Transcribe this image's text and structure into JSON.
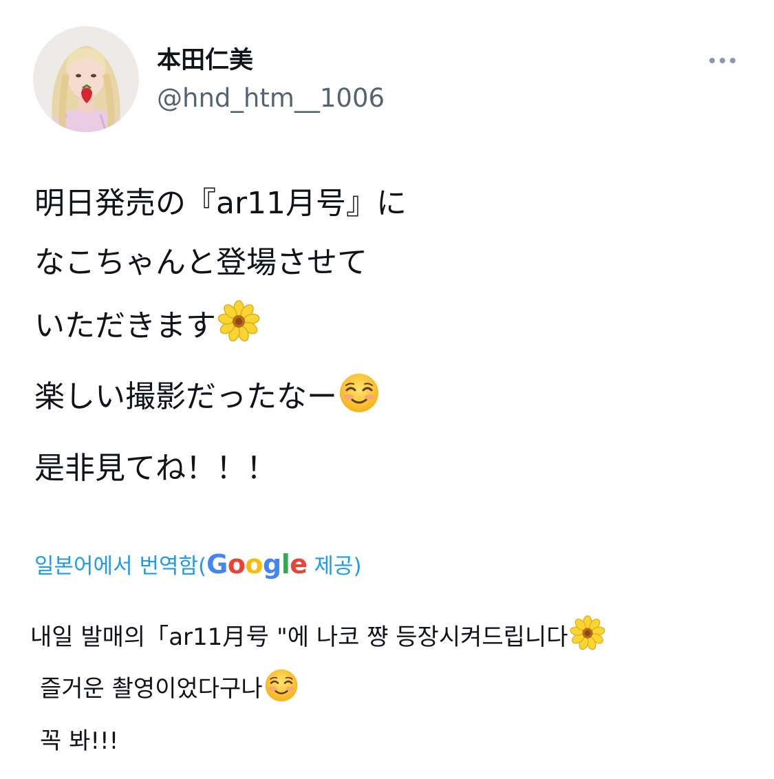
{
  "author": {
    "display_name": "本田仁美",
    "handle": "@hnd_htm__1006"
  },
  "tweet": {
    "lines": [
      "明日発売の『ar11月号』に",
      "なこちゃんと登場させて",
      "いただきます",
      "楽しい撮影だったなー",
      "是非見てね！！！"
    ]
  },
  "translation": {
    "label_prefix": "일본어에서 번역함(",
    "label_suffix": " 제공)",
    "google_letters": [
      "G",
      "o",
      "o",
      "g",
      "l",
      "e"
    ],
    "lines": [
      "내일 발매의「ar11月号 \"에 나코 쨩 등장시켜드립니다",
      "즐거운 촬영이었다구나",
      "꼭 봐!!!"
    ]
  },
  "icons": {
    "more": "more-horizontal-icon",
    "flower": "blossom-emoji",
    "smile": "smiling-face-emoji"
  },
  "colors": {
    "text": "#0f1419",
    "secondary": "#536471",
    "link": "#1d9bf0"
  }
}
